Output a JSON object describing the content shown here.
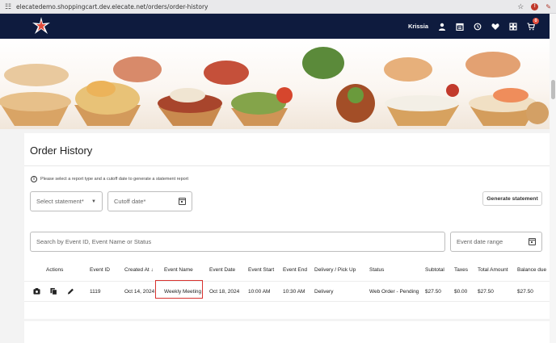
{
  "browser": {
    "url": "elecatedemo.shoppingcart.dev.elecate.net/orders/order-history",
    "icons": [
      "tune-icon",
      "star-icon",
      "profile-icon",
      "pen-icon"
    ]
  },
  "nav": {
    "user_name": "Krissia",
    "cart_count": "0",
    "icons": [
      "user-icon",
      "calendar-icon",
      "history-icon",
      "heart-icon",
      "grid-icon",
      "cart-icon"
    ]
  },
  "colors": {
    "nav_bg": "#0e1b3e",
    "accent": "#e24d3c",
    "highlight_border": "#d8322f"
  },
  "page": {
    "title": "Order History",
    "info_text": "Please select a report type and a cutoff date to generate a statement report",
    "statement_placeholder": "Select statement*",
    "cutoff_placeholder": "Cutoff date*",
    "generate_label": "Generate statement",
    "search_placeholder": "Search by Event ID, Event Name or Status",
    "date_range_placeholder": "Event date range"
  },
  "table": {
    "headers": {
      "actions": "Actions",
      "event_id": "Event ID",
      "created_at": "Created At ↓",
      "event_name": "Event Name",
      "event_date": "Event Date",
      "event_start": "Event Start",
      "event_end": "Event End",
      "delivery": "Delivery / Pick Up",
      "status": "Status",
      "subtotal": "Subtotal",
      "taxes": "Taxes",
      "total": "Total Amount",
      "balance": "Balance due"
    },
    "rows": [
      {
        "event_id": "1119",
        "created_at": "Oct 14, 2024",
        "event_name": "Weekly Meeting",
        "event_date": "Oct 18, 2024",
        "event_start": "10:00 AM",
        "event_end": "10:30 AM",
        "delivery": "Delivery",
        "status": "Web Order - Pending",
        "subtotal": "$27.50",
        "taxes": "$0.00",
        "total": "$27.50",
        "balance": "$27.50",
        "action_icons": [
          "view-icon",
          "copy-icon",
          "edit-icon"
        ]
      }
    ]
  }
}
